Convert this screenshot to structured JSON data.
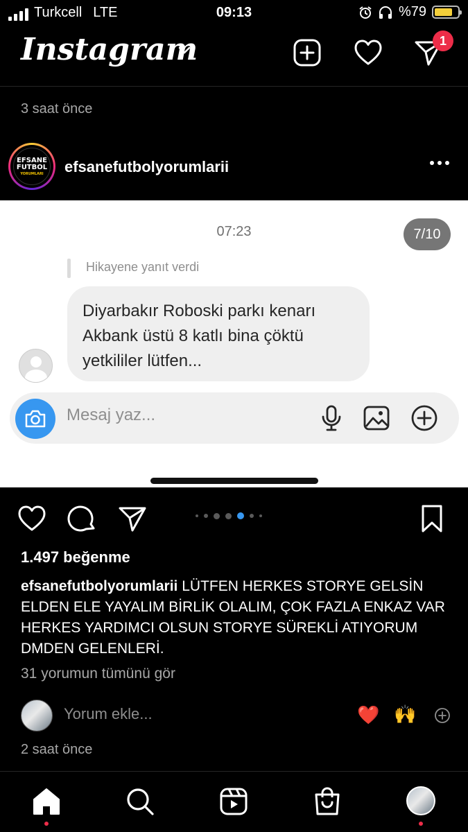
{
  "status_bar": {
    "carrier": "Turkcell",
    "network": "LTE",
    "time": "09:13",
    "battery_percent": "%79",
    "battery_level": 0.79
  },
  "header": {
    "logo": "Instagram",
    "notification_count": "1"
  },
  "previous_post": {
    "time_ago": "3 saat önce"
  },
  "post": {
    "username": "efsanefutbolyorumlarii",
    "avatar_text": [
      "EFSANE",
      "FUTBOL",
      "YORUMLARI"
    ],
    "image": {
      "time": "07:23",
      "counter": "7/10",
      "reply_note": "Hikayene yanıt verdi",
      "message_lines": [
        "Diyarbakır Roboski parkı kenarı",
        "Akbank üstü 8 katlı bina çöktü",
        "yetkililer lütfen..."
      ],
      "composer_placeholder": "Mesaj yaz..."
    },
    "carousel": {
      "count": 7,
      "active_index": 4
    },
    "likes": "1.497 beğenme",
    "caption_username": "efsanefutbolyorumlarii",
    "caption_text": " LÜTFEN HERKES STORYE GELSİN ELDEN ELE YAYALIM BİRLİK OLALIM, ÇOK FAZLA ENKAZ VAR HERKES YARDIMCI OLSUN STORYE SÜREKLİ ATIYORUM DMDEN GELENLERİ.",
    "view_comments": "31 yorumun tümünü gör",
    "add_comment_placeholder": "Yorum ekle...",
    "quick_emojis": [
      "❤️",
      "🙌"
    ],
    "time_ago": "2 saat önce"
  },
  "tabs": [
    "home-icon",
    "search-icon",
    "reels-icon",
    "shop-icon",
    "profile-avatar"
  ],
  "colors": {
    "accent_blue": "#3797f0",
    "badge_red": "#ed2d49",
    "muted_text": "#a8a8a8",
    "battery_yellow": "#f4cf3b"
  }
}
